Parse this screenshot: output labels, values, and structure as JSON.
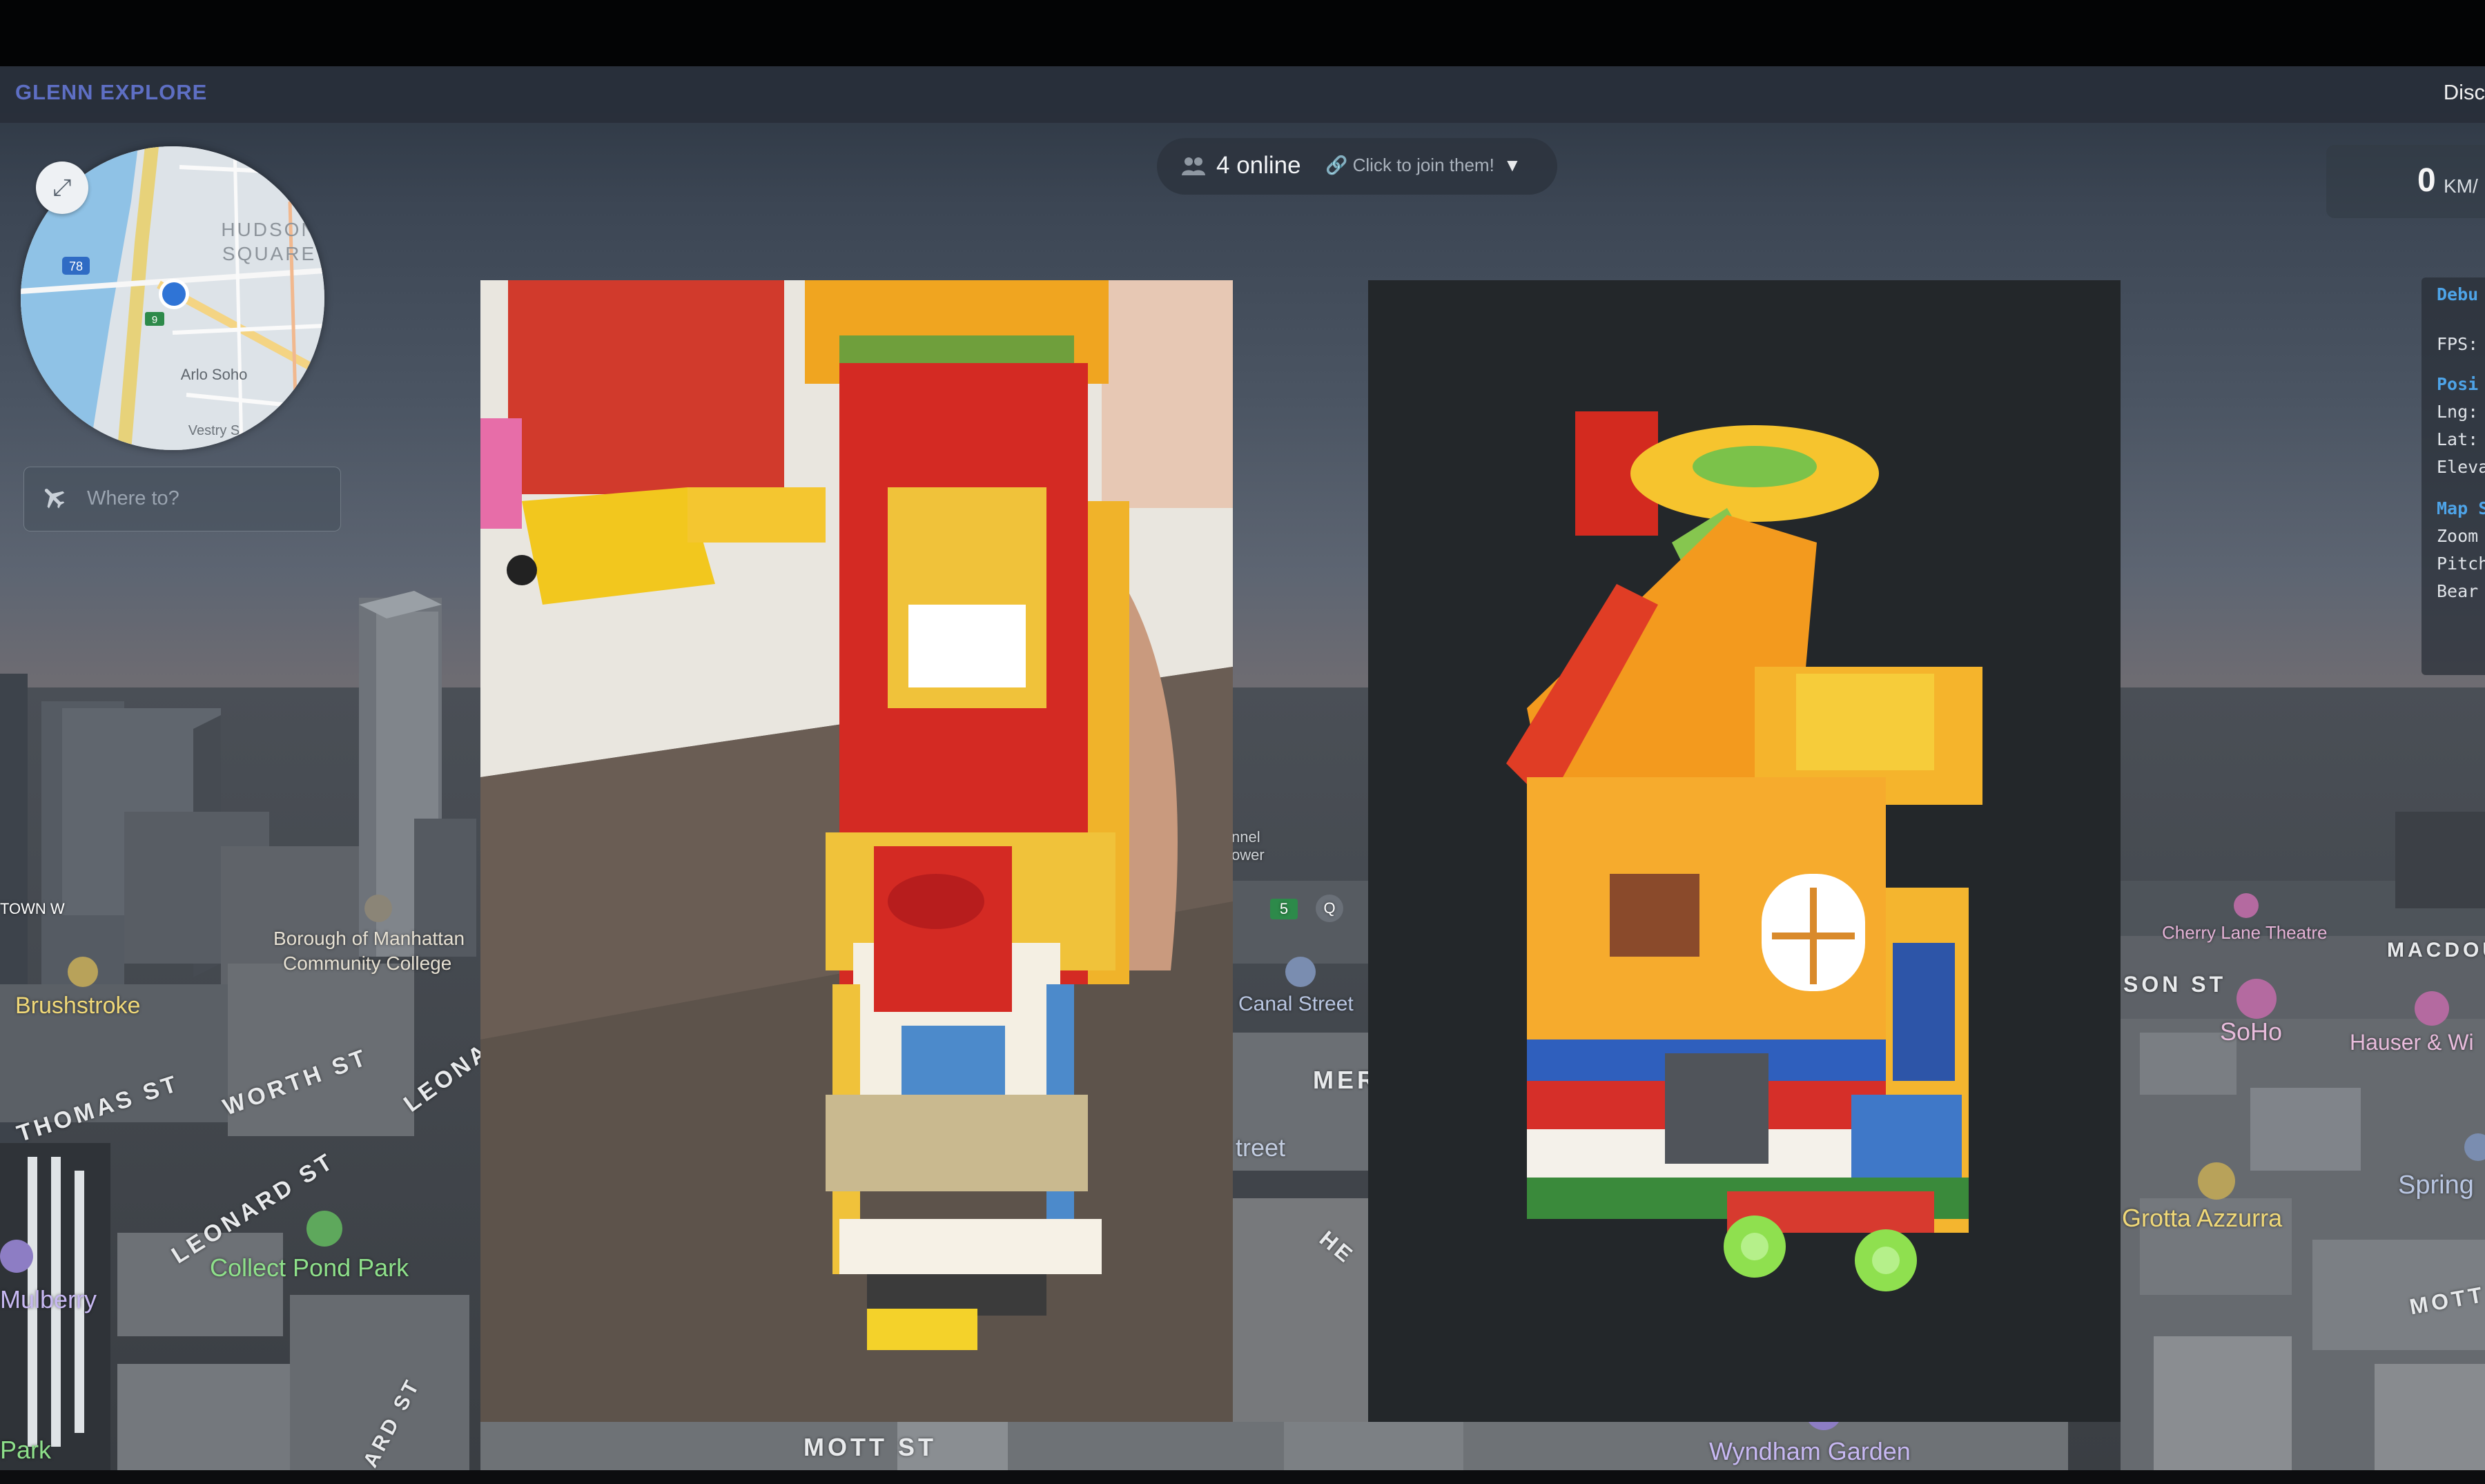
{
  "app": {
    "brand": "GLENN EXPLORE",
    "right_label": "Disc"
  },
  "minimap": {
    "labels": [
      "HUDSON",
      "SQUARE",
      "Arlo Soho",
      "Vestry S"
    ],
    "shields": [
      "78",
      "9"
    ],
    "expand_icon": "expand-arrows-icon"
  },
  "search": {
    "placeholder": "Where to?",
    "icon": "plane-icon"
  },
  "online": {
    "count_label": "4 online",
    "join_label": "Click to join them!",
    "caret": "▼"
  },
  "speed": {
    "value": "0",
    "unit": "KM/"
  },
  "debug": {
    "title": "Debu",
    "fps": "FPS:",
    "position_heading": "Posi",
    "lng": "Lng:",
    "lat": "Lat:",
    "elev": "Eleva",
    "map_heading": "Map S",
    "zoom": "Zoom",
    "pitch": "Pitch",
    "bearing": "Bear"
  },
  "map_labels": {
    "brushstroke": "Brushstroke",
    "bmcc_1": "Borough of Manhattan",
    "bmcc_2": "Community College",
    "thomas_st": "THOMAS ST",
    "worth_st": "WORTH ST",
    "leonard_st": "LEONARD ST",
    "leona": "LEONA",
    "collect_pond": "Collect Pond Park",
    "mulberry": "Mulberry",
    "park": "Park",
    "ard_st": "ARD ST",
    "town_w": "TOWN W",
    "mott_st": "MOTT ST",
    "canal_street": "Canal Street",
    "mer": "MER",
    "treet": "treet",
    "he": "HE",
    "nnel_1": "nnel",
    "nnel_2": "ower",
    "shield_5": "5",
    "shield_q": "Q",
    "wyndham": "Wyndham Garden",
    "cherry_lane": "Cherry Lane Theatre",
    "macdou": "MACDOU",
    "son_st": "SON ST",
    "soho": "SoHo",
    "hauser": "Hauser & Wi",
    "grotta": "Grotta Azzurra",
    "spring": "Spring",
    "mott_right": "MOTT"
  },
  "colors": {
    "brand": "#5e6fc4",
    "debug_heading": "#4ea4e8",
    "park_label": "#8ee08a"
  }
}
